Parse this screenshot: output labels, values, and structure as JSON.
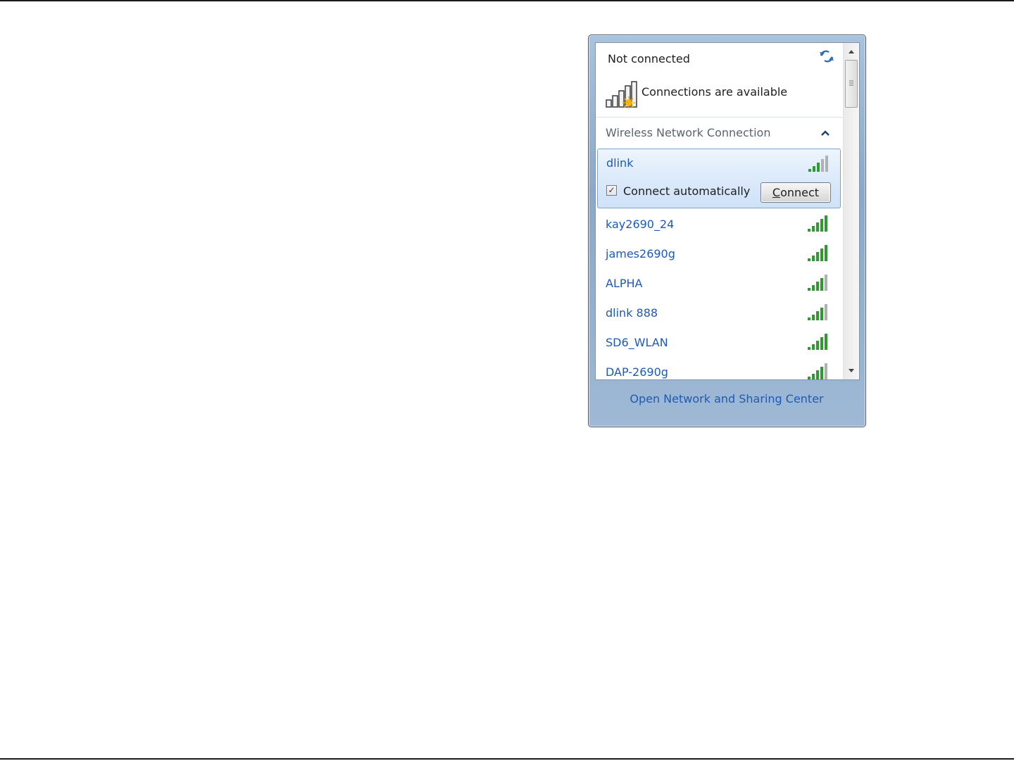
{
  "flyout": {
    "status_title": "Not connected",
    "status_text": "Connections are available",
    "group_label": "Wireless Network Connection",
    "selected_network": {
      "name": "dlink",
      "connect_automatically_label": "Connect automatically",
      "connect_automatically_checked": true,
      "check_mark": "✓",
      "connect_button_first": "C",
      "connect_button_rest": "onnect"
    },
    "networks": [
      {
        "name": "kay2690_24"
      },
      {
        "name": "james2690g"
      },
      {
        "name": "ALPHA"
      },
      {
        "name": "dlink 888"
      },
      {
        "name": "SD6_WLAN"
      },
      {
        "name": "DAP-2690g"
      }
    ],
    "footer_link": "Open Network and Sharing Center",
    "colors": {
      "link": "#1d5ab7",
      "signal_green": "#2f9a2f",
      "signal_gray": "#b0b0b0",
      "selection": "#dceafb"
    }
  }
}
